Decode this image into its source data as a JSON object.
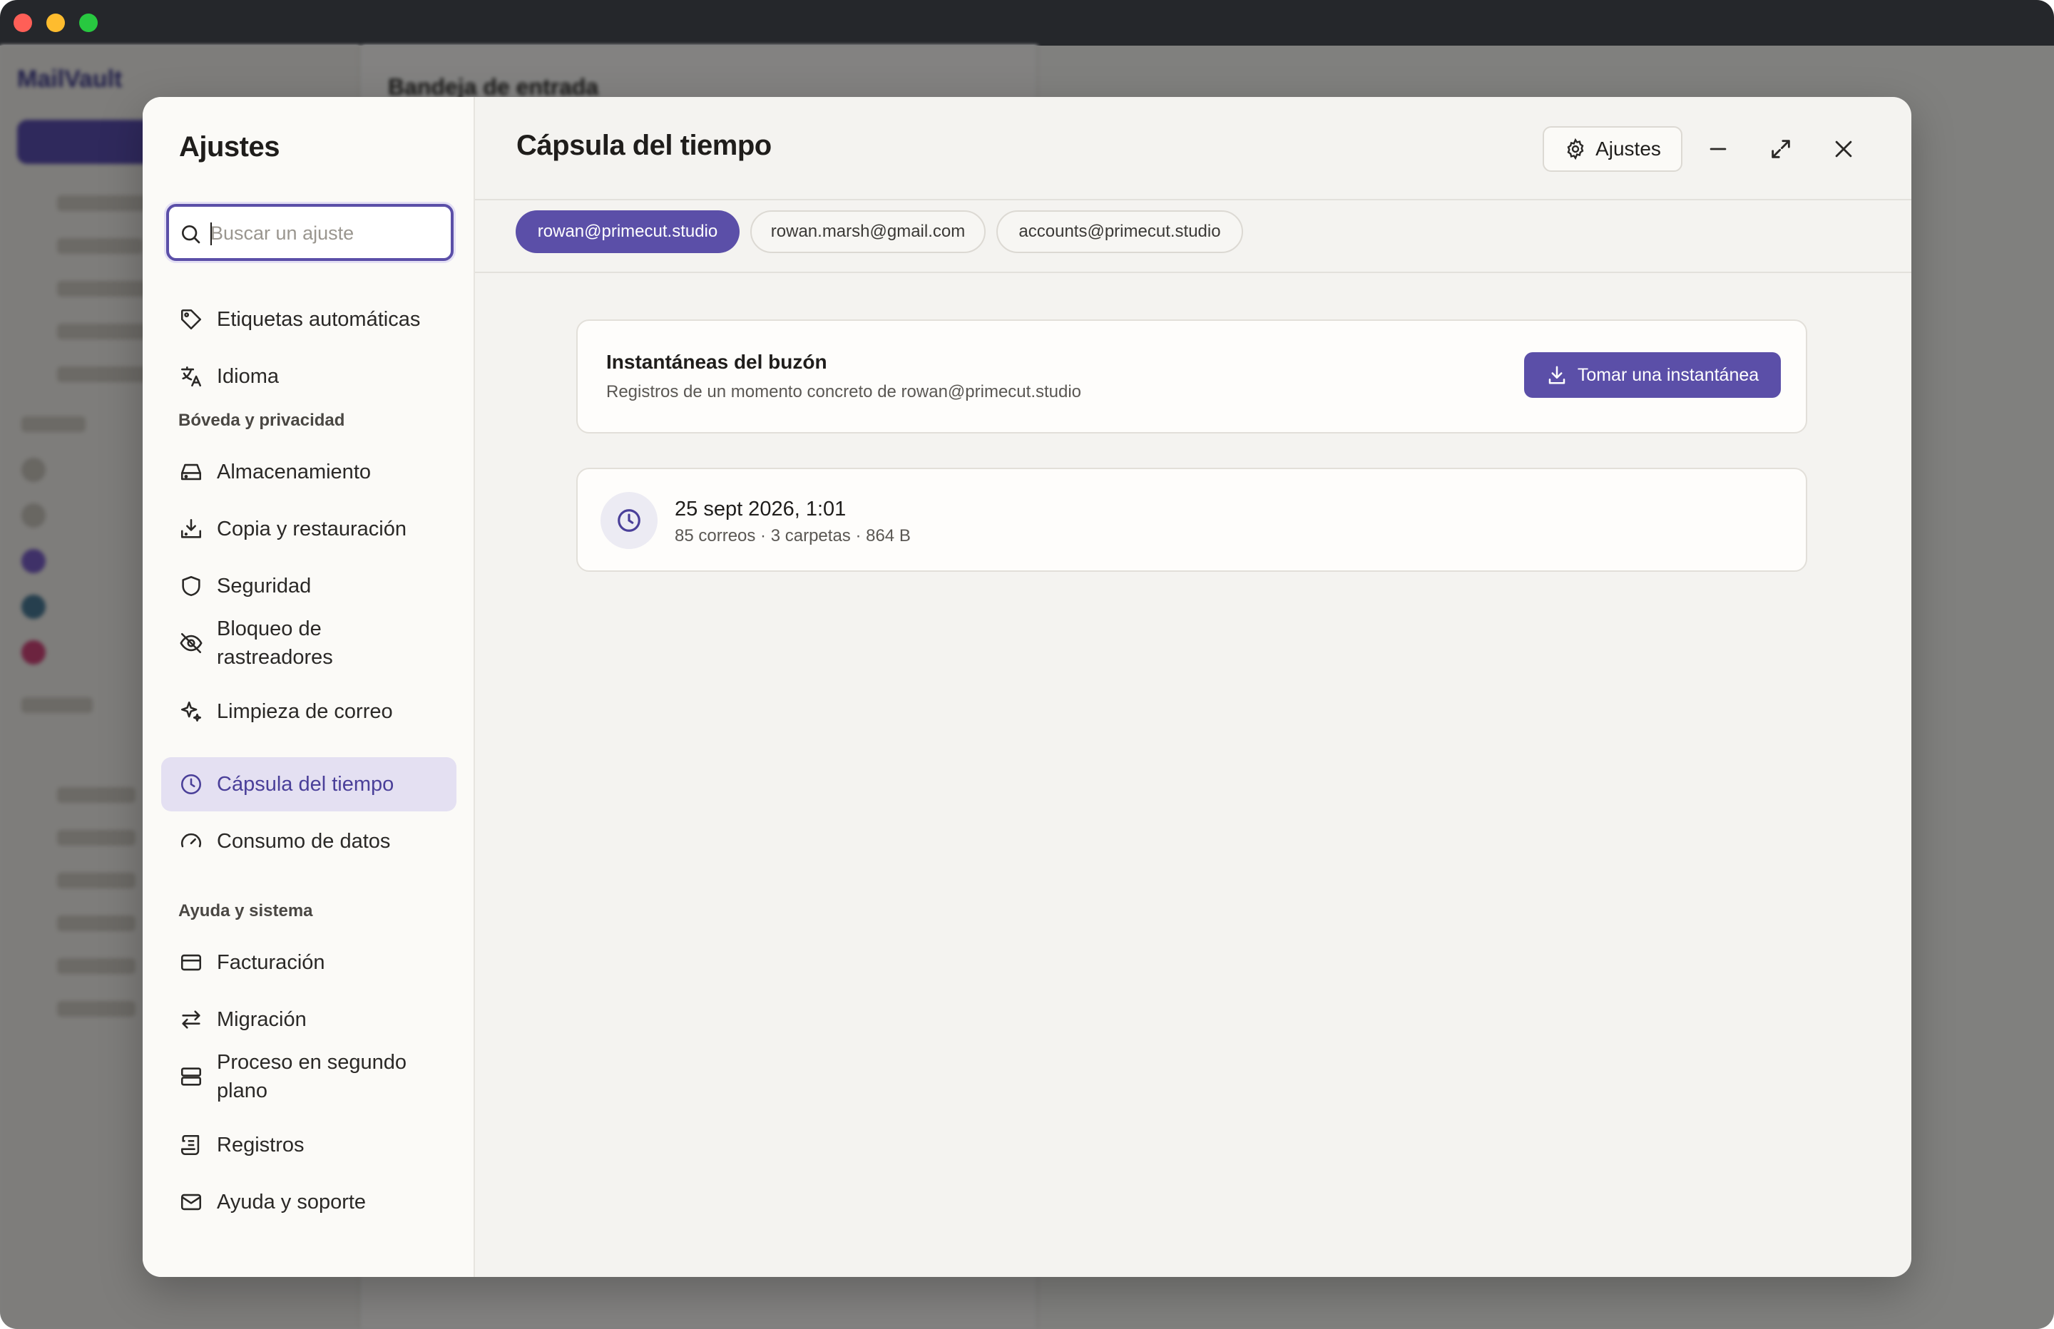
{
  "background_app": {
    "logo": "MailVault",
    "heading": "Bandeja de entrada"
  },
  "sidebar": {
    "title": "Ajustes",
    "search_placeholder": "Buscar un ajuste",
    "items_top": [
      {
        "label": "Etiquetas automáticas",
        "icon": "tag-icon"
      },
      {
        "label": "Idioma",
        "icon": "translate-icon"
      }
    ],
    "section_vault": "Bóveda y privacidad",
    "items_vault": [
      {
        "label": "Almacenamiento",
        "icon": "hard-drive-icon"
      },
      {
        "label": "Copia y restauración",
        "icon": "download-tray-icon"
      },
      {
        "label": "Seguridad",
        "icon": "shield-icon"
      },
      {
        "label": "Bloqueo de rastreadores",
        "icon": "eye-off-icon"
      },
      {
        "label": "Limpieza de correo",
        "icon": "sparkles-icon"
      },
      {
        "label": "Cápsula del tiempo",
        "icon": "clock-icon",
        "active": true
      },
      {
        "label": "Consumo de datos",
        "icon": "gauge-icon"
      }
    ],
    "section_help": "Ayuda y sistema",
    "items_help": [
      {
        "label": "Facturación",
        "icon": "credit-card-icon"
      },
      {
        "label": "Migración",
        "icon": "arrows-swap-icon"
      },
      {
        "label": "Proceso en segundo plano",
        "icon": "server-icon"
      },
      {
        "label": "Registros",
        "icon": "scroll-icon"
      },
      {
        "label": "Ayuda y soporte",
        "icon": "mail-icon"
      }
    ]
  },
  "main": {
    "title": "Cápsula del tiempo",
    "settings_button": "Ajustes",
    "accounts": [
      {
        "label": "rowan@primecut.studio",
        "active": true
      },
      {
        "label": "rowan.marsh@gmail.com",
        "active": false
      },
      {
        "label": "accounts@primecut.studio",
        "active": false
      }
    ],
    "snapshots_card": {
      "title": "Instantáneas del buzón",
      "subtitle": "Registros de un momento concreto de rowan@primecut.studio",
      "button": "Tomar una instantánea"
    },
    "snapshots": [
      {
        "date": "25 sept 2026, 1:01",
        "meta": "85 correos · 3 carpetas · 864 B"
      }
    ]
  },
  "colors": {
    "accent": "#5b4fa8",
    "active_nav_bg": "#e4e0f2"
  }
}
